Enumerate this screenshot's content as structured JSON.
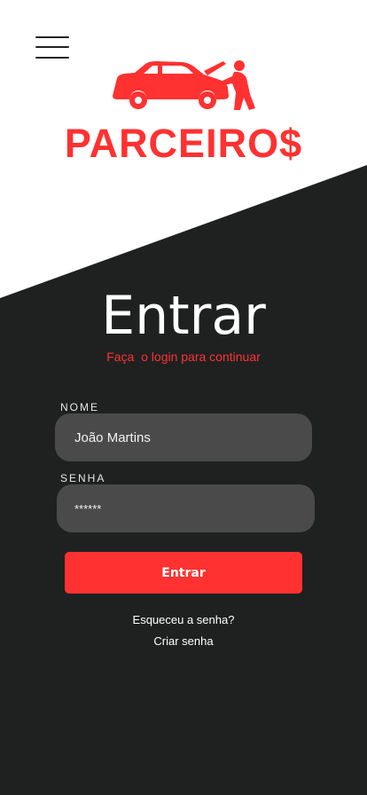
{
  "colors": {
    "accent": "#ff3131",
    "dark": "#1f2121",
    "input_bg": "#4a4a4a",
    "white": "#ffffff"
  },
  "header": {
    "menu_icon": "hamburger-menu-icon",
    "logo_icon": "car-mechanic-icon",
    "brand": "PARCEIRO$"
  },
  "login": {
    "title": "Entrar",
    "subtitle": "Faça  o login para continuar",
    "name_label": "NOME",
    "name_value": "João Martins",
    "password_label": "SENHA",
    "password_value": "******",
    "submit_label": "Entrar",
    "forgot_link": "Esqueceu a senha?",
    "create_link": "Criar senha"
  }
}
